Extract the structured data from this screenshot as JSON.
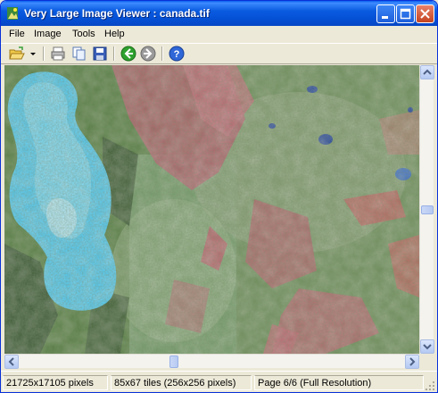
{
  "window": {
    "title": "Very Large Image Viewer : canada.tif",
    "app_icon": "viewer-app-icon",
    "controls": [
      "minimize-icon",
      "maximize-icon",
      "close-icon"
    ]
  },
  "menu": {
    "items": [
      "File",
      "Image",
      "Tools",
      "Help"
    ]
  },
  "toolbar": {
    "buttons": [
      "open-folder-icon",
      "dropdown-arrow-icon",
      "print-icon",
      "copy-icon",
      "save-icon",
      "back-icon",
      "forward-icon",
      "help-icon"
    ]
  },
  "status": {
    "dimensions": "21725x17105 pixels",
    "tiles": "85x67 tiles (256x256 pixels)",
    "page": "Page 6/6 (Full Resolution)"
  },
  "colors": {
    "titlebar": "#0a5be0",
    "lake": "#4fd0ff",
    "vegetation": "#4e7d3a",
    "reddish_terrain": "#c25a6a"
  },
  "scroll": {
    "vertical_position": 0.5,
    "horizontal_position": 0.4
  }
}
